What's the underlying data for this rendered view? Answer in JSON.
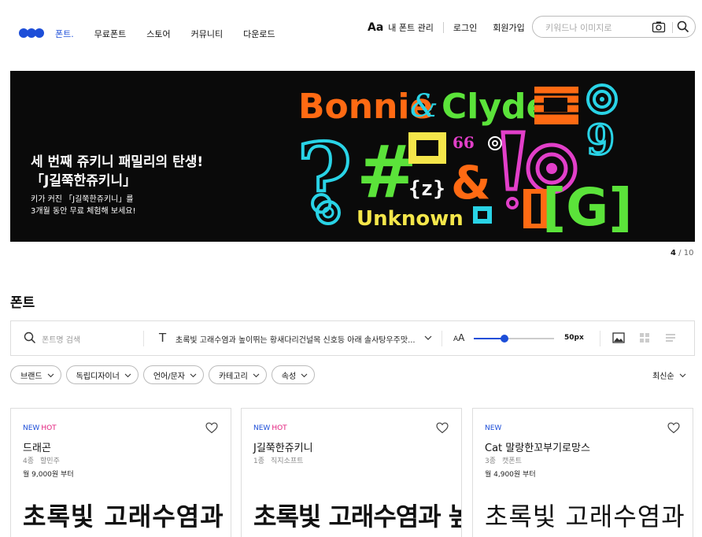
{
  "nav": {
    "items": [
      {
        "label": "폰트.",
        "active": true
      },
      {
        "label": "무료폰트"
      },
      {
        "label": "스토어"
      },
      {
        "label": "커뮤니티"
      },
      {
        "label": "다운로드"
      }
    ]
  },
  "header": {
    "aa_icon": "Aa",
    "my_fonts": "내 폰트 관리",
    "login": "로그인",
    "signup": "회원가입",
    "search_placeholder": "키워드나 이미지로"
  },
  "banner": {
    "title_line1": "세 번째 쥬키니 패밀리의 탄생!",
    "title_line2": "「J길쭉한쥬키니」",
    "sub_line1": "키가 커진 「J길쭉한쥬키니」를",
    "sub_line2": "3개월 동안 무료 체험해 보세요!",
    "art": {
      "bonnie": "Bonnie",
      "amp": "&",
      "clyde": "Clyde",
      "z": "{z}",
      "unknown": "Unknown",
      "g": "[G]",
      "hash": "#",
      "q": "?",
      "quote": "66"
    },
    "counter_current": "4",
    "counter_sep": " / ",
    "counter_total": "10"
  },
  "section": {
    "title": "폰트"
  },
  "toolbar": {
    "search_placeholder": "폰트명 검색",
    "text_icon": "T",
    "sample_text": "초록빛 고래수염과 높이뛰는 황새다리건널목 신호등 아래 솔사탕우주맛...",
    "size_icon_small": "A",
    "size_icon_big": "A",
    "size_value": "50px",
    "size_fraction": 0.38
  },
  "filters": {
    "chips": [
      "브랜드",
      "독립디자이너",
      "언어/문자",
      "카테고리",
      "속성"
    ],
    "sort": "최신순"
  },
  "cards": [
    {
      "new": "NEW",
      "hot": "HOT",
      "name": "드래곤",
      "count": "4종",
      "maker": "할민주",
      "price": "월 9,000원 부터",
      "preview": "초록빛 고래수염과"
    },
    {
      "new": "NEW",
      "hot": "HOT",
      "name": "J길쭉한쥬키니",
      "count": "1종",
      "maker": "직지소프트",
      "price": "",
      "preview": "초록빛 고래수염과 높이뛰"
    },
    {
      "new": "NEW",
      "hot": "",
      "name": "Cat 말랑한꼬부기로망스",
      "count": "3종",
      "maker": "캣폰트",
      "price": "월 4,900원 부터",
      "preview": "초록빛 고래수염과 높이"
    }
  ],
  "colors": {
    "accent": "#1d4ed8",
    "hot": "#e21b7a",
    "banner_bg": "#0a0a0a",
    "art_orange": "#ff6a13",
    "art_green": "#5be33a",
    "art_cyan": "#29d3e6",
    "art_yellow": "#f4e64a",
    "art_pink": "#e23fc9"
  }
}
